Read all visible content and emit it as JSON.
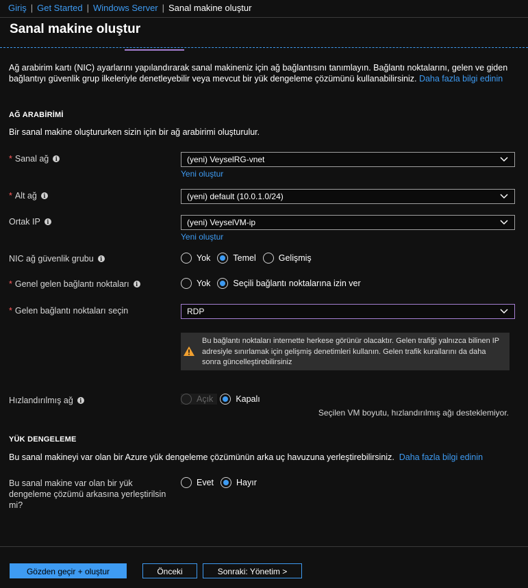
{
  "breadcrumb": {
    "items": [
      "Giriş",
      "Get Started",
      "Windows Server"
    ],
    "current": "Sanal makine oluştur"
  },
  "page": {
    "title": "Sanal makine oluştur"
  },
  "description": {
    "text": "Ağ arabirim kartı (NIC) ayarlarını yapılandırarak sanal makineniz için ağ bağlantısını tanımlayın. Bağlantı noktalarını, gelen ve giden bağlantıyı güvenlik grup ilkeleriyle denetleyebilir veya mevcut bir yük dengeleme çözümünü kullanabilirsiniz.",
    "link": "Daha fazla bilgi edinin"
  },
  "nic_section": {
    "heading": "AĞ ARABİRİMİ",
    "subtitle": "Bir sanal makine oluştururken sizin için bir ağ arabirimi oluşturulur."
  },
  "fields": {
    "vnet": {
      "label": "Sanal ağ",
      "value": "(yeni) VeyselRG-vnet",
      "new_link": "Yeni oluştur"
    },
    "subnet": {
      "label": "Alt ağ",
      "value": "(yeni) default (10.0.1.0/24)"
    },
    "public_ip": {
      "label": "Ortak IP",
      "value": "(yeni) VeyselVM-ip",
      "new_link": "Yeni oluştur"
    },
    "nsg": {
      "label": "NIC ağ güvenlik grubu",
      "options": [
        "Yok",
        "Temel",
        "Gelişmiş"
      ],
      "selected": "Temel"
    },
    "public_ports": {
      "label": "Genel gelen bağlantı noktaları",
      "options": [
        "Yok",
        "Seçili bağlantı noktalarına izin ver"
      ],
      "selected": "Seçili bağlantı noktalarına izin ver"
    },
    "inbound_ports": {
      "label": "Gelen bağlantı noktaları seçin",
      "value": "RDP"
    },
    "warning": "Bu bağlantı noktaları internette herkese görünür olacaktır. Gelen trafiği yalnızca bilinen IP adresiyle sınırlamak için gelişmiş denetimleri kullanın. Gelen trafik kurallarını da daha sonra güncelleştirebilirsiniz",
    "accelerated": {
      "label": "Hızlandırılmış ağ",
      "options": [
        "Açık",
        "Kapalı"
      ],
      "selected": "Kapalı",
      "note": "Seçilen VM boyutu, hızlandırılmış ağı desteklemiyor."
    }
  },
  "lb_section": {
    "heading": "YÜK DENGELEME",
    "subtitle": "Bu sanal makineyi var olan bir Azure yük dengeleme çözümünün arka uç havuzuna yerleştirebilirsiniz.",
    "link": "Daha fazla bilgi edinin",
    "question": "Bu sanal makine var olan bir yük dengeleme çözümü arkasına yerleştirilsin mi?",
    "options": [
      "Evet",
      "Hayır"
    ],
    "selected": "Hayır"
  },
  "footer": {
    "review": "Gözden geçir + oluştur",
    "prev": "Önceki",
    "next": "Sonraki: Yönetim >"
  },
  "colors": {
    "background": "#111111",
    "accent": "#3e9bf2",
    "focus": "#a67fd3",
    "required": "#ff5a5a",
    "warning": "#f0a030"
  }
}
